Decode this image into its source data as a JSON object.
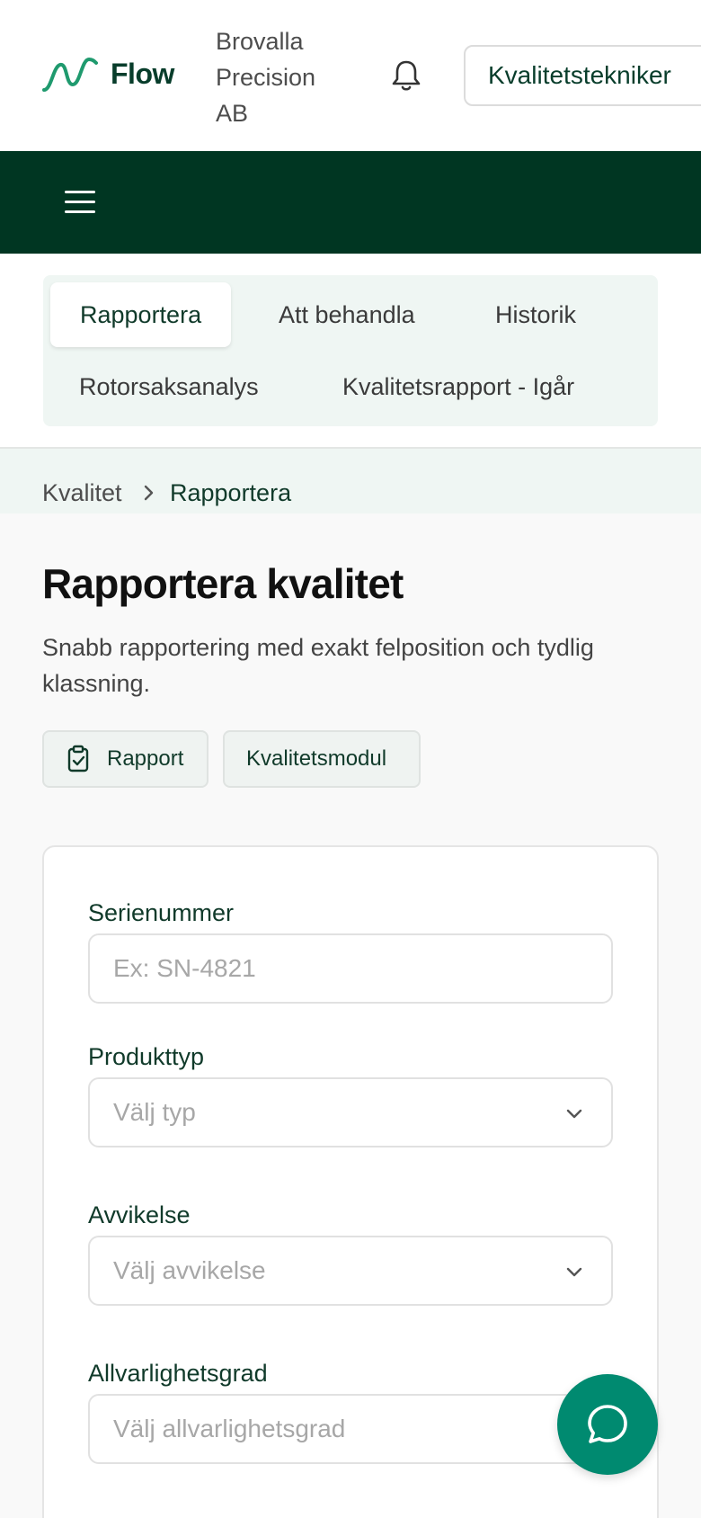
{
  "header": {
    "logo_text": "Flow",
    "company_name": "Brovalla Precision AB",
    "role_button_label": "Kvalitetstekniker",
    "brand_color": "#083d2b",
    "nav_color": "#003622"
  },
  "tabs": [
    {
      "label": "Rapportera",
      "active": true
    },
    {
      "label": "Att behandla",
      "active": false
    },
    {
      "label": "Historik",
      "active": false
    },
    {
      "label": "Rotorsaksanalys",
      "active": false
    },
    {
      "label": "Kvalitetsrapport - Igår",
      "active": false
    }
  ],
  "breadcrumb": {
    "parent": "Kvalitet",
    "current": "Rapportera"
  },
  "page": {
    "title": "Rapportera kvalitet",
    "description": "Snabb rapportering med exakt felposition och tydlig klassning."
  },
  "chips": [
    {
      "label": "Rapport",
      "icon": "clipboard-check-icon"
    },
    {
      "label": "Kvalitetsmodul"
    }
  ],
  "form": {
    "serial": {
      "label": "Serienummer",
      "placeholder": "Ex: SN-4821",
      "value": ""
    },
    "product_type": {
      "label": "Produkttyp",
      "placeholder": "Välj typ"
    },
    "deviation": {
      "label": "Avvikelse",
      "placeholder": "Välj avvikelse"
    },
    "severity": {
      "label": "Allvarlighetsgrad",
      "placeholder": "Välj allvarlighetsgrad"
    }
  },
  "fab": {
    "icon": "chat-icon",
    "color": "#008a70"
  }
}
